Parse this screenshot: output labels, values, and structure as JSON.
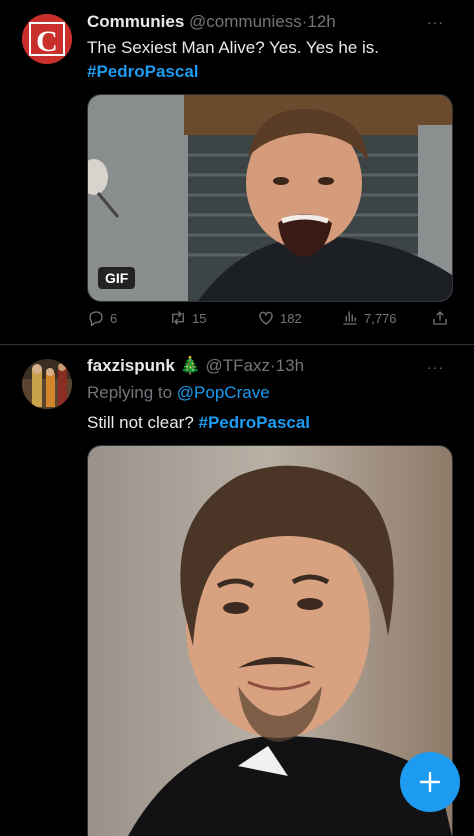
{
  "tweets": [
    {
      "author_name": "Communies",
      "author_handle": "@communiess",
      "separator": "·",
      "time": "12h",
      "text_line1": "The Sexiest Man Alive? Yes. Yes he is.",
      "hashtag": "#PedroPascal",
      "media_badge": "GIF",
      "avatar_letter": "C",
      "more": "···",
      "stats": {
        "replies": "6",
        "retweets": "15",
        "likes": "182",
        "views": "7,776"
      }
    },
    {
      "author_name": "faxzispunk",
      "author_emoji": "🎄",
      "author_handle": "@TFaxz",
      "separator": "·",
      "time": "13h",
      "reply_prefix": "Replying to",
      "reply_to": "@PopCrave",
      "text": "Still not clear?",
      "hashtag": "#PedroPascal",
      "more": "···"
    }
  ],
  "compose_button": "+",
  "colors": {
    "background": "#000000",
    "accent": "#1d9bf0",
    "muted": "#71767b",
    "text": "#e7e9ea"
  },
  "icons": [
    "reply-icon",
    "retweet-icon",
    "like-icon",
    "views-icon",
    "share-icon",
    "compose-plus-icon"
  ]
}
